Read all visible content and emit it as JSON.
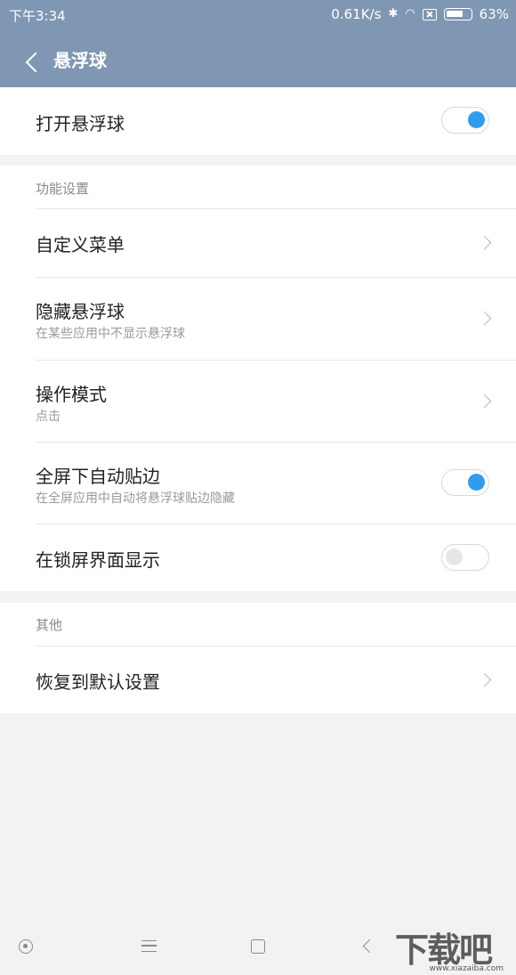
{
  "status_bar": {
    "time": "下午3:34",
    "speed": "0.61K/s",
    "battery": "63%"
  },
  "header": {
    "title": "悬浮球"
  },
  "main_toggle": {
    "label": "打开悬浮球",
    "on": true
  },
  "function_section": {
    "label": "功能设置",
    "items": [
      {
        "label": "自定义菜单",
        "type": "link"
      },
      {
        "label": "隐藏悬浮球",
        "sub": "在某些应用中不显示悬浮球",
        "type": "link"
      },
      {
        "label": "操作模式",
        "sub": "点击",
        "type": "link"
      },
      {
        "label": "全屏下自动贴边",
        "sub": "在全屏应用中自动将悬浮球贴边隐藏",
        "type": "toggle",
        "on": true
      },
      {
        "label": "在锁屏界面显示",
        "type": "toggle",
        "on": false
      }
    ]
  },
  "other_section": {
    "label": "其他",
    "items": [
      {
        "label": "恢复到默认设置",
        "type": "link"
      }
    ]
  },
  "watermark": {
    "text": "下载吧",
    "site": "www.xiazaiba.com"
  },
  "colors": {
    "header_bg": "#7f97b3",
    "accent": "#2f9cf0",
    "page_bg": "#f2f2f2"
  }
}
